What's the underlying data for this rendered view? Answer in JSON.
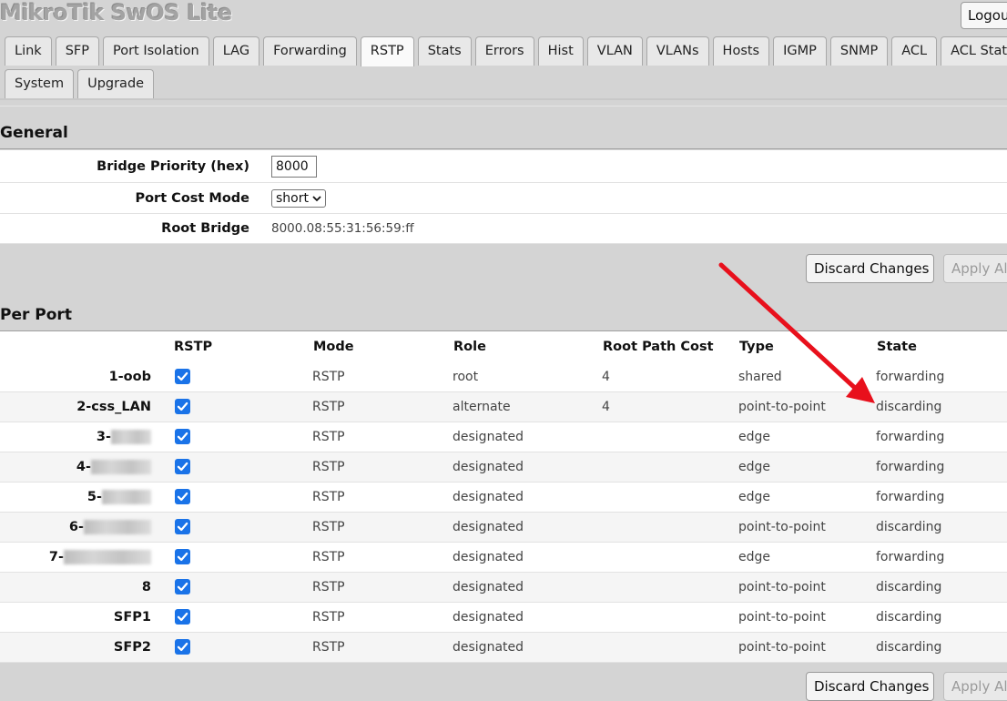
{
  "app": {
    "title": "MikroTik SwOS Lite",
    "logout_label": "Logout"
  },
  "tabs_row1": [
    "Link",
    "SFP",
    "Port Isolation",
    "LAG",
    "Forwarding",
    "RSTP",
    "Stats",
    "Errors",
    "Hist",
    "VLAN",
    "VLANs",
    "Hosts",
    "IGMP",
    "SNMP",
    "ACL",
    "ACL Stats"
  ],
  "tabs_row2": [
    "System",
    "Upgrade"
  ],
  "active_tab": "RSTP",
  "general": {
    "heading": "General",
    "bridge_priority_label": "Bridge Priority (hex)",
    "bridge_priority_value": "8000",
    "port_cost_mode_label": "Port Cost Mode",
    "port_cost_mode_value": "short",
    "root_bridge_label": "Root Bridge",
    "root_bridge_value": "8000.08:55:31:56:59:ff"
  },
  "buttons": {
    "discard": "Discard Changes",
    "apply": "Apply All"
  },
  "per_port": {
    "heading": "Per Port",
    "columns": [
      "RSTP",
      "Mode",
      "Role",
      "Root Path Cost",
      "Type",
      "State"
    ],
    "rows": [
      {
        "port": "1-oob",
        "rstp": true,
        "mode": "RSTP",
        "role": "root",
        "cost": "4",
        "type": "shared",
        "state": "forwarding"
      },
      {
        "port": "2-css_LAN",
        "rstp": true,
        "mode": "RSTP",
        "role": "alternate",
        "cost": "4",
        "type": "point-to-point",
        "state": "discarding"
      },
      {
        "port": "3-",
        "rstp": true,
        "mode": "RSTP",
        "role": "designated",
        "cost": "",
        "type": "edge",
        "state": "forwarding"
      },
      {
        "port": "4-",
        "rstp": true,
        "mode": "RSTP",
        "role": "designated",
        "cost": "",
        "type": "edge",
        "state": "forwarding"
      },
      {
        "port": "5-",
        "rstp": true,
        "mode": "RSTP",
        "role": "designated",
        "cost": "",
        "type": "edge",
        "state": "forwarding"
      },
      {
        "port": "6-",
        "rstp": true,
        "mode": "RSTP",
        "role": "designated",
        "cost": "",
        "type": "point-to-point",
        "state": "discarding"
      },
      {
        "port": "7-",
        "rstp": true,
        "mode": "RSTP",
        "role": "designated",
        "cost": "",
        "type": "edge",
        "state": "forwarding"
      },
      {
        "port": "8",
        "rstp": true,
        "mode": "RSTP",
        "role": "designated",
        "cost": "",
        "type": "point-to-point",
        "state": "discarding"
      },
      {
        "port": "SFP1",
        "rstp": true,
        "mode": "RSTP",
        "role": "designated",
        "cost": "",
        "type": "point-to-point",
        "state": "discarding"
      },
      {
        "port": "SFP2",
        "rstp": true,
        "mode": "RSTP",
        "role": "designated",
        "cost": "",
        "type": "point-to-point",
        "state": "discarding"
      }
    ]
  },
  "annotation": {
    "arrow_color": "#e8101c"
  }
}
